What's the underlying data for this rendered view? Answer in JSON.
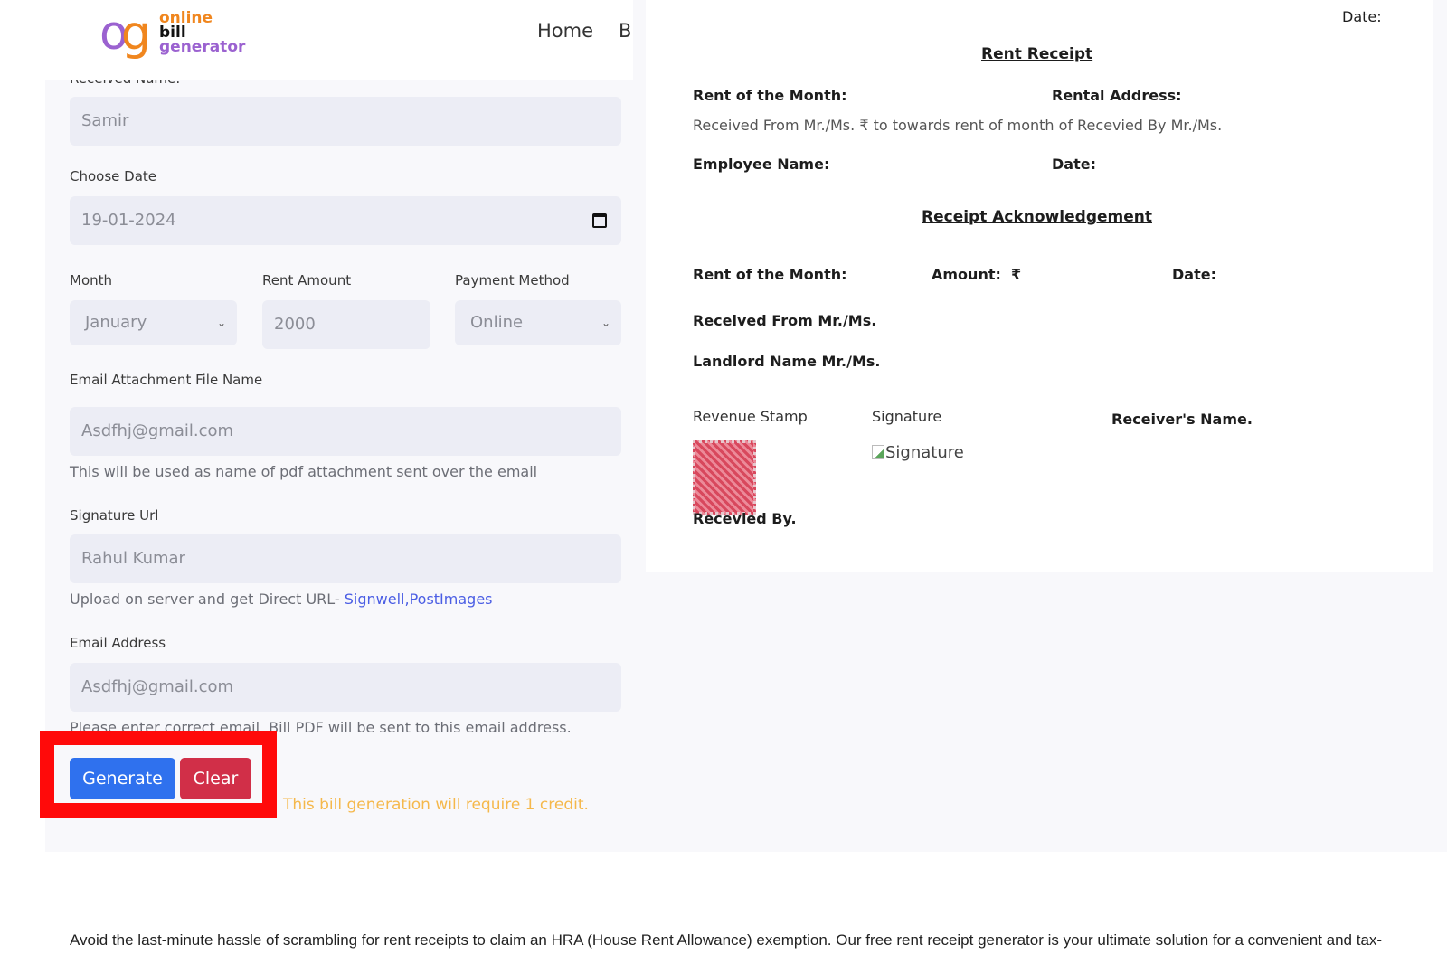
{
  "header": {
    "logo": {
      "mono_o": "o",
      "mono_g": "g",
      "line1": "online",
      "line2": "bill",
      "line3": "generator"
    },
    "nav": [
      "Home",
      "B"
    ]
  },
  "form": {
    "received_name": {
      "label": "Received Name:",
      "value": "Samir"
    },
    "date": {
      "label": "Choose Date",
      "value": "19-01-2024"
    },
    "month": {
      "label": "Month",
      "value": "January"
    },
    "rent_amount": {
      "label": "Rent Amount",
      "value": "2000"
    },
    "payment_method": {
      "label": "Payment Method",
      "value": "Online"
    },
    "attachment_name": {
      "label": "Email Attachment File Name",
      "value": "Asdfhj@gmail.com",
      "help": "This will be used as name of pdf attachment sent over the email"
    },
    "signature_url": {
      "label": "Signature Url",
      "value": "Rahul Kumar",
      "help_prefix": "Upload on server and get Direct URL- ",
      "link1": "Signwell",
      "link_sep": ",",
      "link2": "PostImages"
    },
    "email": {
      "label": "Email Address",
      "value": "Asdfhj@gmail.com",
      "help": "Please enter correct email. Bill PDF will be sent to this email address."
    },
    "generate_label": "Generate",
    "clear_label": "Clear",
    "credit_note": "This bill generation will require 1 credit."
  },
  "receipt": {
    "top_date": "Date:",
    "title": "Rent Receipt",
    "rent_month": "Rent of the Month:",
    "rental_address": "Rental Address:",
    "sentence": "Received From Mr./Ms. ₹ to towards rent of month of Recevied By Mr./Ms.",
    "employee_name": "Employee Name:",
    "date": "Date:",
    "ack_title": "Receipt Acknowledgement",
    "ack_rent_month": "Rent of the Month:",
    "ack_amount": "Amount:  ₹",
    "ack_date": "Date:",
    "ack_received_from": "Received From Mr./Ms.",
    "ack_landlord": "Landlord Name Mr./Ms.",
    "revenue_stamp": "Revenue Stamp",
    "signature": "Signature",
    "signature_alt": "Signature",
    "receivers_name": "Receiver's Name.",
    "received_by": "Recevied By."
  },
  "footer": {
    "intro": "Avoid the last-minute hassle of scrambling for rent receipts to claim an HRA (House Rent Allowance) exemption. Our free rent receipt generator is your ultimate solution for a convenient and tax-"
  },
  "colors": {
    "generate": "#2f71ee",
    "clear": "#d12f48",
    "highlight": "#ff0a0a",
    "credit_note": "#f5b84b",
    "logo_purple": "#9b62d0",
    "logo_orange": "#f0861e"
  }
}
